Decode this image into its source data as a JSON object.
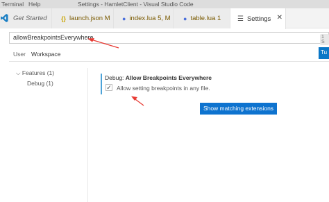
{
  "window": {
    "menu": [
      "Terminal",
      "Help"
    ],
    "title": "Settings - HamletClient - Visual Studio Code"
  },
  "tabs": [
    {
      "label": "Get Started",
      "icon": "vscode-tab-icon"
    },
    {
      "label": "launch.json M",
      "icon": "json-braces-icon"
    },
    {
      "label": "index.lua 5, M",
      "icon": "lua-moon-icon"
    },
    {
      "label": "table.lua 1",
      "icon": "lua-moon-icon"
    },
    {
      "label": "Settings",
      "icon": "settings-lines-icon"
    }
  ],
  "search": {
    "value": "allowBreakpointsEverywhere",
    "count": "1 S"
  },
  "scopes": {
    "user": "User",
    "workspace": "Workspace"
  },
  "turn_button": "Tu",
  "toc": {
    "features": "Features (1)",
    "debug": "Debug (1)"
  },
  "setting": {
    "category": "Debug: ",
    "name": "Allow Breakpoints Everywhere",
    "checkbox_label": "Allow setting breakpoints in any file.",
    "checked": true
  },
  "button": {
    "show_matching": "Show matching extensions"
  },
  "colors": {
    "accent": "#0e73cf",
    "annotation_arrow": "#e83b34"
  }
}
